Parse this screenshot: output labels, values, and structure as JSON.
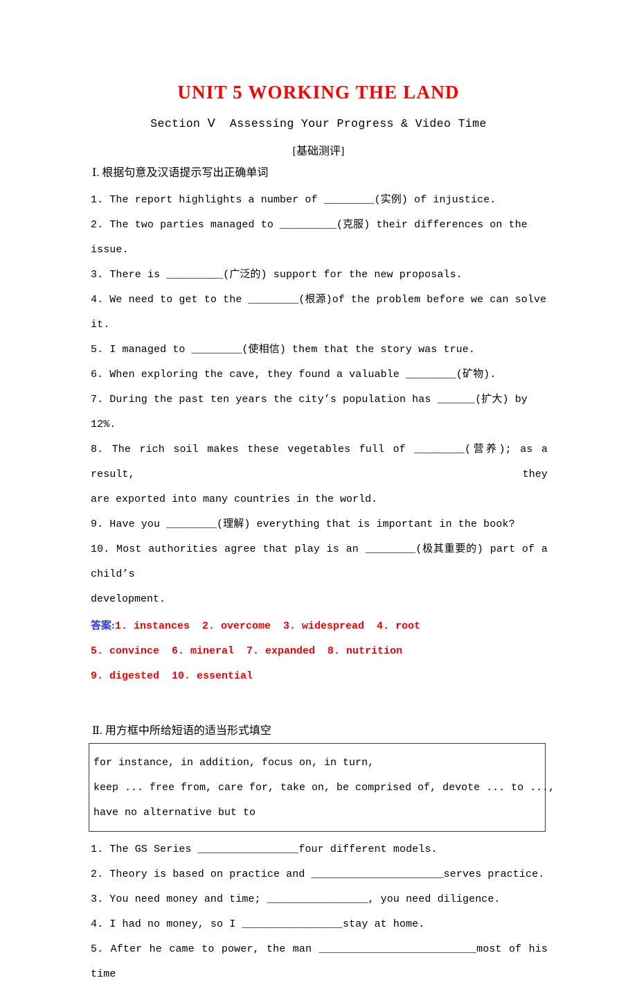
{
  "document": {
    "title": "UNIT 5 WORKING THE LAND",
    "section_line": "Section Ⅴ  Assessing Your Progress & Video Time",
    "bracket_line": "[基础测评]",
    "title_color": "#ff0000",
    "answer_color": "#ff0000",
    "answer_label_color": "#2b3ed8"
  },
  "part1": {
    "heading": "Ⅰ. 根据句意及汉语提示写出正确单词",
    "questions": [
      "1. The report highlights a number of ________(实例) of injustice.",
      "2. The two parties managed to _________(克服) their differences on the issue.",
      "3. There is _________(广泛的) support for the new proposals.",
      "4. We need to get to the ________(根源)of the problem before we can solve it.",
      "5. I managed to ________(使相信) them that the story was true.",
      "6. When exploring the cave, they found a valuable ________(矿物).",
      "7. During the past ten years the city’s population has ______(扩大) by 12%.",
      "8. The rich soil makes these vegetables full of ________(营养); as a result, they",
      "are exported into many countries in the world.",
      "9. Have you ________(理解) everything that is important in the book?",
      "10. Most authorities agree that play is an ________(极其重要的) part of a child’s",
      "development."
    ],
    "answers_label": "答案:",
    "answers": [
      "1. instances  2. overcome  3. widespread  4. root",
      "5. convince  6. mineral  7. expanded  8. nutrition",
      "9. digested  10. essential"
    ]
  },
  "part2": {
    "heading": "Ⅱ. 用方框中所给短语的适当形式填空",
    "phrase_box": [
      "for instance, in addition, focus on, in turn,",
      "keep ... free from, care for, take on, be comprised of, devote ... to ...,",
      "have no alternative but to"
    ],
    "questions": [
      "1. The GS Series ________________four different models.",
      "2. Theory is based on practice and _____________________serves practice.",
      "3. You need money and time; ________________, you need diligence.",
      "4. I had no money, so I ________________stay at home.",
      "5. After he came to power, the man _________________________most of his time"
    ]
  }
}
